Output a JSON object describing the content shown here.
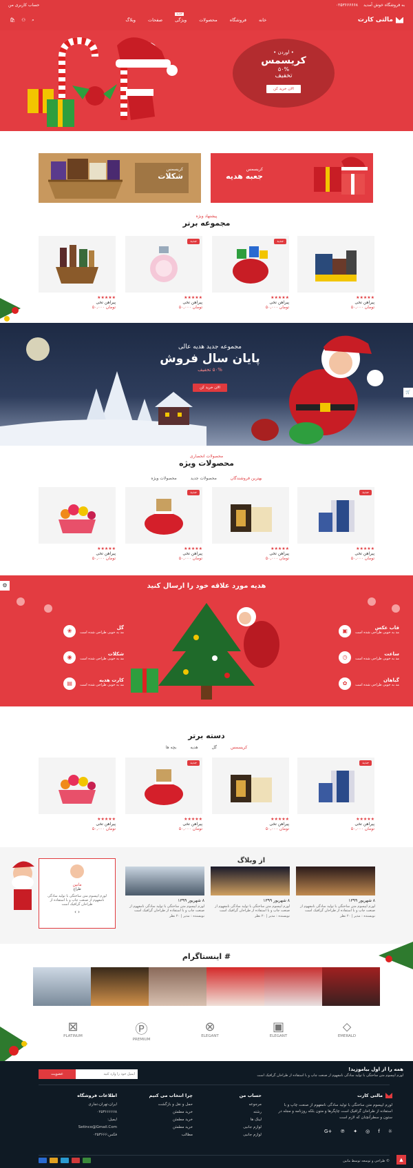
{
  "topbar": {
    "welcome": "به فروشگاه خوش آمدید",
    "phone": "۰۲۵۳۶۶۶۶۶۸",
    "account": "حساب کاربری من"
  },
  "nav": {
    "logo": "مالتی کارت",
    "menu": [
      "خانه",
      "فروشگاه",
      "محصولات",
      "ویژگی",
      "صفحات",
      "وبلاگ"
    ],
    "new_badge": "جدید"
  },
  "hero": {
    "line1": "• اوردن •",
    "line2": "کریسمس",
    "line3": "۵۰%",
    "line4": "تخفیف",
    "button": "الان خرید کن"
  },
  "promos": [
    {
      "small": "کریسمس",
      "big": "جعبه هدیه"
    },
    {
      "small": "کریسمس",
      "big": "شکلات"
    }
  ],
  "top_collection": {
    "sub": "پیشنهاد ویژه",
    "title": "مجموعه برتر"
  },
  "products_1": [
    {
      "name": "پیراهن تخی",
      "price": "۵۰,۰۰۰ تومان",
      "badge": ""
    },
    {
      "name": "پیراهن تخی",
      "price": "۵۰,۰۰۰ تومان",
      "badge": "جدید"
    },
    {
      "name": "پیراهن تخی",
      "price": "۵۰,۰۰۰ تومان",
      "badge": "جدید"
    },
    {
      "name": "پیراهن تخی",
      "price": "۵۰,۰۰۰ تومان",
      "badge": ""
    }
  ],
  "banner2": {
    "line1": "مجموعه جدید هدیه عالی",
    "line2": "پایان سال فروش",
    "line3": "۵۰% تخفیف",
    "button": "الان خرید کن"
  },
  "featured": {
    "sub": "محصولات انحصاری",
    "title": "محصولات ویژه",
    "tabs": [
      "بهترین فروشندگان",
      "محصولات جدید",
      "محصولات ویژه"
    ]
  },
  "products_2": [
    {
      "name": "پیراهن تخی",
      "price": "۵۰,۰۰۰ تومان",
      "badge": "جدید"
    },
    {
      "name": "پیراهن تخی",
      "price": "۵۰,۰۰۰ تومان",
      "badge": ""
    },
    {
      "name": "پیراهن تخی",
      "price": "۵۰,۰۰۰ تومان",
      "badge": "جدید"
    },
    {
      "name": "پیراهن تخی",
      "price": "۵۰,۰۰۰ تومان",
      "badge": ""
    }
  ],
  "gifts": {
    "title": "هدیه مورد علاقه خود را ارسال کنید",
    "right": [
      {
        "t": "قاب عکس",
        "d": "مد به خوبی طراحی شده است"
      },
      {
        "t": "ساعت",
        "d": "مد به خوبی طراحی شده است"
      },
      {
        "t": "گیاهان",
        "d": "مد به خوبی طراحی شده است"
      }
    ],
    "left": [
      {
        "t": "گل",
        "d": "مد به خوبی طراحی شده است"
      },
      {
        "t": "شکلات",
        "d": "مد به خوبی طراحی شده است"
      },
      {
        "t": "کارت هدیه",
        "d": "مد به خوبی طراحی شده است"
      }
    ]
  },
  "top_category": {
    "title": "دسته برتر",
    "tabs": [
      "کریسمس",
      "گل",
      "هدیه",
      "بچه ها"
    ]
  },
  "products_3": [
    {
      "name": "پیراهن تخی",
      "price": "۵۰,۰۰۰ تومان",
      "badge": "جدید"
    },
    {
      "name": "پیراهن تخی",
      "price": "۵۰,۰۰۰ تومان",
      "badge": ""
    },
    {
      "name": "پیراهن تخی",
      "price": "۵۰,۰۰۰ تومان",
      "badge": "جدید"
    },
    {
      "name": "پیراهن تخی",
      "price": "۵۰,۰۰۰ تومان",
      "badge": ""
    }
  ],
  "blog": {
    "title": "از وبلاگ",
    "posts": [
      {
        "date": "۸ شهریور ۱۳۹۹",
        "text": "لورم ایپسوم متن ساختگی با تولید سادگی نامفهوم از صنعت چاپ و با استفاده از طراحان گرافیک است",
        "meta": "نویسنده : مدیر | ۲۰ نظر"
      },
      {
        "date": "۸ شهریور ۱۳۹۹",
        "text": "لورم ایپسوم متن ساختگی با تولید سادگی نامفهوم از صنعت چاپ و با استفاده از طراحان گرافیک است",
        "meta": "نویسنده : مدیر | ۲۰ نظر"
      },
      {
        "date": "۸ شهریور ۱۳۹۹",
        "text": "لورم ایپسوم متن ساختگی با تولید سادگی نامفهوم از صنعت چاپ و با استفاده از طراحان گرافیک است",
        "meta": "نویسنده : مدیر | ۲۰ نظر"
      }
    ],
    "testimonial": {
      "name": "مانین",
      "role": "طراح",
      "text": "لورم ایپسوم متن ساختگی با تولید سادگی نامفهوم از صنعت چاپ و با استفاده از طراحان گرافیک است"
    }
  },
  "instagram": {
    "title": "# اینستاگرام"
  },
  "brands": [
    "EMERALD",
    "ELEGANT",
    "ELEGANT",
    "PREMIUM",
    "PLATINUM"
  ],
  "newsletter": {
    "title": "همه را از اول بیاموزید!",
    "text": "لورم ایپسوم متن ساختگی با تولید سادگی نامفهوم از صنعت چاپ و با استفاده از طراحان گرافیک است",
    "placeholder": "ایمیل خود را وارد کنید",
    "button": "عضویت"
  },
  "footer": {
    "logo": "مالتی کارت",
    "about": "لورم ایپسوم متن ساختگی با تولید سادگی نامفهوم از صنعت چاپ و با استفاده از طراحان گرافیک است چاپگرها و متون بلکه روزنامه و مجله در ستون و سطرآنچنان که لازم است",
    "col1": {
      "title": "حساب من",
      "items": [
        "مرجوعه",
        "رشته",
        "لینک ها",
        "لوازم جانبی",
        "لوازم جانبی"
      ]
    },
    "col2": {
      "title": "چرا انتخاب می کنیم",
      "items": [
        "حمل و نقل و بازگشت",
        "خرید مطمئن",
        "خرید مطمئن",
        "خرید مطمئن",
        "مطالب"
      ]
    },
    "col3": {
      "title": "اطلاعات فروشگاه",
      "items": [
        "ایران،تهران،تجاری",
        "۰۲۵۳۶۶۶۶۶۸",
        "ایمیل:",
        "Setinco@Gmail.Com",
        "فکس:۰۲۵۳۶۶۶"
      ]
    },
    "copyright": "© طراحی و توسعه توسط مانین"
  }
}
